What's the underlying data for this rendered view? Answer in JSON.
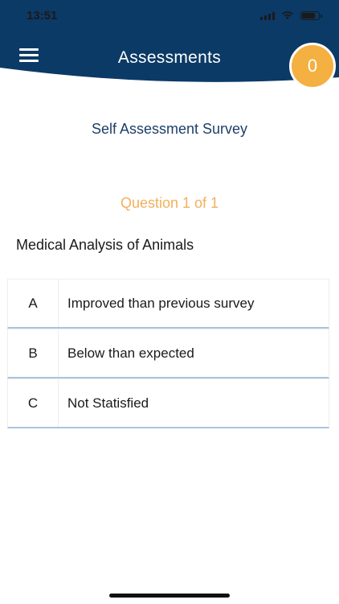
{
  "status_bar": {
    "time": "13:51"
  },
  "header": {
    "title": "Assessments",
    "badge_count": "0",
    "bg_color": "#0b3a66",
    "badge_color": "#f4b040"
  },
  "icons": {
    "menu": "hamburger-menu-icon",
    "signal": "cellular-signal-icon",
    "wifi": "wifi-icon",
    "battery": "battery-icon"
  },
  "survey": {
    "title": "Self Assessment Survey",
    "question_count": "Question 1 of 1",
    "question": "Medical Analysis of Animals",
    "options": [
      {
        "letter": "A",
        "text": "Improved than previous survey"
      },
      {
        "letter": "B",
        "text": "Below than expected"
      },
      {
        "letter": "C",
        "text": "Not Statisfied"
      }
    ]
  }
}
